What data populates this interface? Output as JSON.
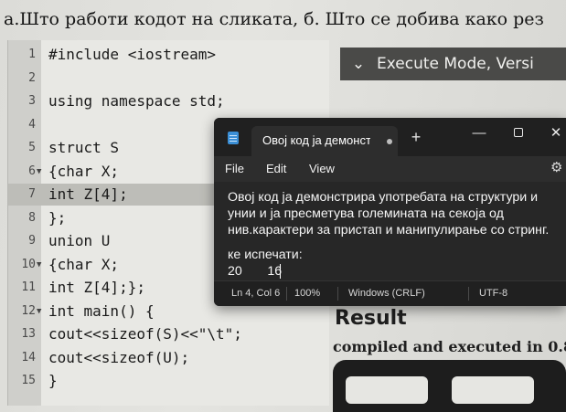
{
  "paper": {
    "question": "а.Што работи кодот на сликата, б. Што се добива како рез",
    "code_lines": [
      {
        "num": "1",
        "text": "#include <iostream>",
        "fold": ""
      },
      {
        "num": "2",
        "text": "",
        "fold": ""
      },
      {
        "num": "3",
        "text": "using namespace std;",
        "fold": ""
      },
      {
        "num": "4",
        "text": "",
        "fold": ""
      },
      {
        "num": "5",
        "text": "struct S",
        "fold": ""
      },
      {
        "num": "6",
        "text": "{char X;",
        "fold": "▼"
      },
      {
        "num": "7",
        "text": "int Z[4];",
        "fold": ""
      },
      {
        "num": "8",
        "text": "};",
        "fold": ""
      },
      {
        "num": "9",
        "text": "union U",
        "fold": ""
      },
      {
        "num": "10",
        "text": "{char X;",
        "fold": "▼"
      },
      {
        "num": "11",
        "text": "int Z[4];};",
        "fold": ""
      },
      {
        "num": "12",
        "text": "int main() {",
        "fold": "▼"
      },
      {
        "num": "13",
        "text": "cout<<sizeof(S)<<\"\\t\";",
        "fold": ""
      },
      {
        "num": "14",
        "text": "cout<<sizeof(U);",
        "fold": ""
      },
      {
        "num": "15",
        "text": "}",
        "fold": ""
      }
    ],
    "execute_header": "Execute Mode, Versi",
    "result_title": "Result",
    "result_subtitle": "compiled and executed in 0.8"
  },
  "notepad": {
    "tab_title": "Овој код ја демонстри",
    "new_tab_label": "+",
    "window_controls": {
      "minimize": "—",
      "maximize": "",
      "close": "✕"
    },
    "menu": [
      "File",
      "Edit",
      "View"
    ],
    "settings_icon": "gear-icon",
    "text_lines": [
      "Овој код ја демонстрира употребата на структури и",
      "унии и ја пресметува големината на секоја од",
      "нив.карактери за пристап и манипулирање со стринг.",
      "",
      "ке испечати:",
      "20       16"
    ],
    "status": {
      "position": "Ln 4, Col 6",
      "zoom": "100%",
      "line_ending": "Windows (CRLF)",
      "encoding": "UTF-8"
    }
  },
  "colors": {
    "notepad_bg": "#202020",
    "notepad_content_bg": "#272727",
    "icon_accent": "#3b8fd6"
  }
}
